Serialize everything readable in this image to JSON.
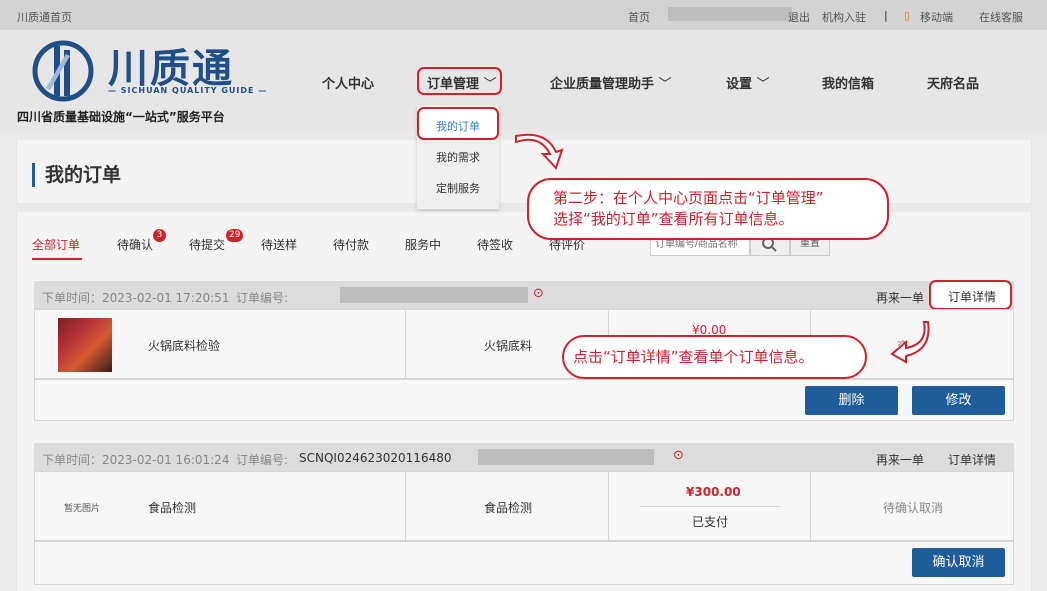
{
  "topbar": {
    "site_home": "川质通首页",
    "home": "首页",
    "logout": "退出",
    "org_entry": "机构入驻",
    "mobile": "移动端",
    "online_service": "在线客服"
  },
  "logo": {
    "name": "川质通",
    "subtitle": "— SICHUAN QUALITY GUIDE —",
    "slogan": "四川省质量基础设施“一站式”服务平台"
  },
  "nav": {
    "personal": "个人中心",
    "order_mgmt": "订单管理",
    "quality_assistant": "企业质量管理助手",
    "settings": "设置",
    "mailbox": "我的信箱",
    "tianfu": "天府名品"
  },
  "dropdown": {
    "items": [
      "我的订单",
      "我的需求",
      "定制服务"
    ]
  },
  "page_title": "我的订单",
  "tabs": [
    {
      "label": "全部订单"
    },
    {
      "label": "待确认",
      "badge": "3"
    },
    {
      "label": "待提交",
      "badge": "29"
    },
    {
      "label": "待送样"
    },
    {
      "label": "待付款"
    },
    {
      "label": "服务中"
    },
    {
      "label": "待签收"
    },
    {
      "label": "待评价"
    }
  ],
  "search": {
    "placeholder": "订单编号/商品名称",
    "reset": "重置"
  },
  "orders": [
    {
      "time_label": "下单时间：2023-02-01 17:20:51",
      "no_label": "订单编号:",
      "no_value": "",
      "reorder": "再来一单",
      "detail": "订单详情",
      "product": "火锅底料检验",
      "category": "火锅底料",
      "price": "¥0.00",
      "status": "交",
      "buttons": [
        "删除",
        "修改"
      ]
    },
    {
      "time_label": "下单时间：2023-02-01 16:01:24",
      "no_label": "订单编号:",
      "no_value": "SCNQI024623020116480",
      "reorder": "再来一单",
      "detail": "订单详情",
      "no_image": "暂无图片",
      "product": "食品检测",
      "category": "食品检测",
      "price": "¥300.00",
      "paid": "已支付",
      "status": "待确认取消",
      "buttons": [
        "确认取消"
      ]
    }
  ],
  "callouts": {
    "step2_line1": "第二步：在个人中心页面点击“订单管理”",
    "step2_line2": "选择“我的订单”查看所有订单信息。",
    "detail_tip": "点击“订单详情”查看单个订单信息。"
  },
  "colors": {
    "accent_red": "#d0222b",
    "brand_blue": "#1e5c9a"
  }
}
